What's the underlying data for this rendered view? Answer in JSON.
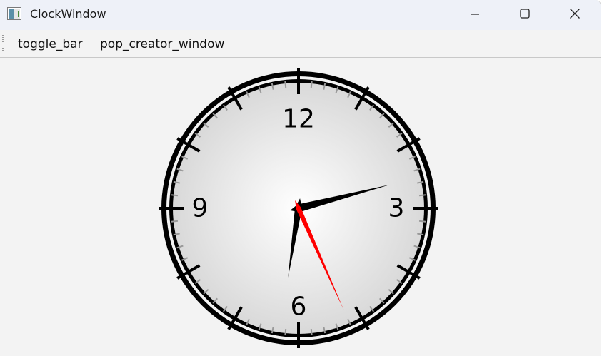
{
  "window": {
    "title": "ClockWindow"
  },
  "titlebar_icons": {
    "app": "app-window-icon",
    "minimize": "minimize-icon",
    "maximize": "maximize-icon",
    "close": "close-icon"
  },
  "toolbar": {
    "items": [
      {
        "label": "toggle_bar"
      },
      {
        "label": "pop_creator_window"
      }
    ]
  },
  "clock": {
    "numerals": [
      "12",
      "3",
      "6",
      "9"
    ],
    "time": {
      "hour": 2,
      "minute": 31,
      "second": 26
    },
    "colors": {
      "rim": "#000000",
      "face_center": "#ffffff",
      "face_edge": "#d9d9d9",
      "second_hand": "#ff0000",
      "hour_minute_hands": "#000000",
      "minor_ticks": "#999999"
    }
  }
}
